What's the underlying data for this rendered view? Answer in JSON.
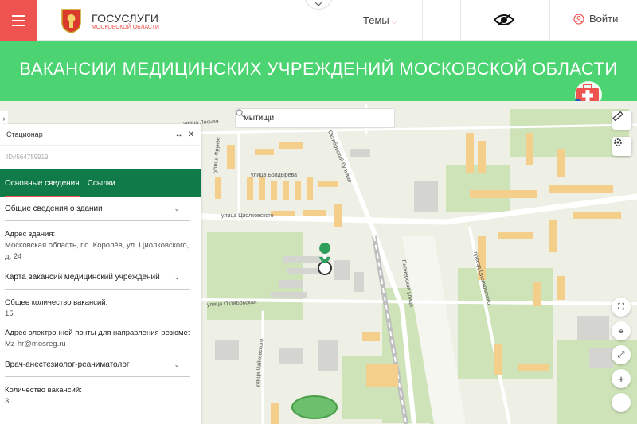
{
  "header": {
    "logo_title": "ГОСУСЛУГИ",
    "logo_subtitle": "МОСКОВСКОЙ ОБЛАСТИ",
    "themes_label": "Темы",
    "login_label": "Войти"
  },
  "banner": {
    "title": "ВАКАНСИИ МЕДИЦИНСКИХ УЧРЕЖДЕНИЙ МОСКОВСКОЙ ОБЛАСТИ"
  },
  "map": {
    "search_value": "мытищи",
    "streets": [
      "улица Лесная",
      "улица Болдырева",
      "улица Циолковского",
      "улица Октябрьская",
      "улица Чайковского",
      "Октябрьский бульвар",
      "улица Фрунзе",
      "проезд Циолковского",
      "Пионерская улица"
    ]
  },
  "panel": {
    "header_title": "Стационар",
    "record_id": "ID#564759919",
    "tabs": [
      "Основные сведения",
      "Ссылки"
    ],
    "section_building": "Общие сведения о здании",
    "address_label": "Адрес здания:",
    "address_value": "Московская область, г.о. Королёв, ул. Циолковского, д. 24",
    "section_map": "Карта вакансий медицинский учреждений",
    "total_label": "Общее количество вакансий:",
    "total_value": "15",
    "email_label": "Адрес электронной почты для направления резюме:",
    "email_value": "Mz-hr@mosreg.ru",
    "section_position": "Врач-анестезиолог-реаниматолог",
    "count_label": "Количество вакансий:",
    "count_value": "3"
  },
  "colors": {
    "brand_red": "#ef5350",
    "banner_green": "#4cd472",
    "tabs_green": "#107a48",
    "marker_green": "#2e9e5b"
  }
}
